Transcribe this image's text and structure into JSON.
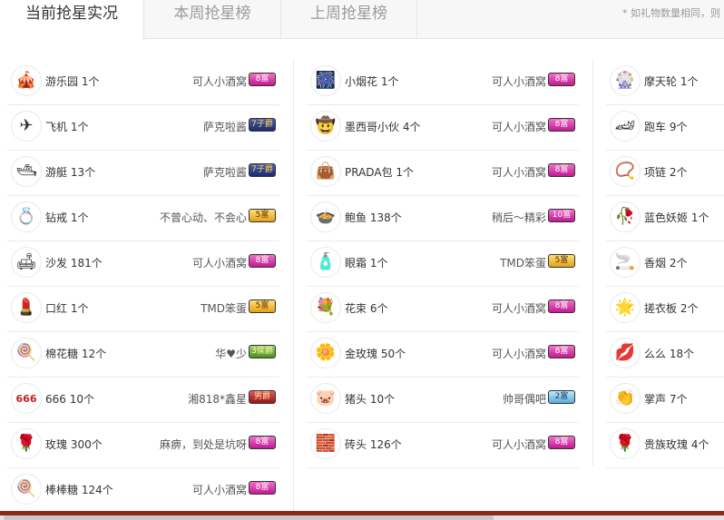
{
  "tabs": [
    {
      "label": "当前抢星实况",
      "active": true
    },
    {
      "label": "本周抢星榜",
      "active": false
    },
    {
      "label": "上周抢星榜",
      "active": false
    }
  ],
  "note": "* 如礼物数量相同，则",
  "columns": [
    [
      {
        "gift": "游乐园 1个",
        "user": "可人小酒窝",
        "badge": "8富",
        "color": "pink",
        "icon": "amusement-park",
        "glyph": "🎪"
      },
      {
        "gift": "飞机 1个",
        "user": "萨克啦酱",
        "badge": "7子爵",
        "color": "navy",
        "icon": "airplane",
        "glyph": "✈"
      },
      {
        "gift": "游艇 13个",
        "user": "萨克啦酱",
        "badge": "7子爵",
        "color": "navy",
        "icon": "yacht",
        "glyph": "🛥"
      },
      {
        "gift": "钻戒 1个",
        "user": "不曾心动、不会心",
        "badge": "5富",
        "color": "gold",
        "icon": "diamond-ring",
        "glyph": "💍"
      },
      {
        "gift": "沙发 181个",
        "user": "可人小酒窝",
        "badge": "8富",
        "color": "pink",
        "icon": "sofa",
        "glyph": "🛋"
      },
      {
        "gift": "口红 1个",
        "user": "TMD笨蛋",
        "badge": "5富",
        "color": "gold",
        "icon": "lipstick",
        "glyph": "💄"
      },
      {
        "gift": "棉花糖 12个",
        "user": "华♥少",
        "badge": "3侯爵",
        "color": "green",
        "icon": "cotton-candy",
        "glyph": "🍭"
      },
      {
        "gift": "666 10个",
        "user": "湘818*鑫星",
        "badge": "男爵",
        "color": "red",
        "icon": "666",
        "glyph": "666"
      },
      {
        "gift": "玫瑰 300个",
        "user": "麻痹，到处是坑呀",
        "badge": "8富",
        "color": "pink",
        "icon": "rose",
        "glyph": "🌹"
      },
      {
        "gift": "棒棒糖 124个",
        "user": "可人小酒窝",
        "badge": "8富",
        "color": "pink",
        "icon": "lollipop",
        "glyph": "🍭"
      }
    ],
    [
      {
        "gift": "小烟花 1个",
        "user": "可人小酒窝",
        "badge": "8富",
        "color": "pink",
        "icon": "fireworks",
        "glyph": "🎆"
      },
      {
        "gift": "墨西哥小伙 4个",
        "user": "可人小酒窝",
        "badge": "8富",
        "color": "pink",
        "icon": "mexican-guy",
        "glyph": "🤠"
      },
      {
        "gift": "PRADA包 1个",
        "user": "可人小酒窝",
        "badge": "8富",
        "color": "pink",
        "icon": "handbag",
        "glyph": "👜"
      },
      {
        "gift": "鲍鱼 138个",
        "user": "稍后～精彩",
        "badge": "10富",
        "color": "pink",
        "icon": "abalone",
        "glyph": "🍲"
      },
      {
        "gift": "眼霜 1个",
        "user": "TMD笨蛋",
        "badge": "5富",
        "color": "gold",
        "icon": "eye-cream",
        "glyph": "🧴"
      },
      {
        "gift": "花束 6个",
        "user": "可人小酒窝",
        "badge": "8富",
        "color": "pink",
        "icon": "bouquet",
        "glyph": "💐"
      },
      {
        "gift": "金玫瑰 50个",
        "user": "可人小酒窝",
        "badge": "8富",
        "color": "pink",
        "icon": "gold-rose",
        "glyph": "🌼"
      },
      {
        "gift": "猪头 10个",
        "user": "帅哥偶吧",
        "badge": "2富",
        "color": "cyan",
        "icon": "pig-head",
        "glyph": "🐷"
      },
      {
        "gift": "砖头 126个",
        "user": "可人小酒窝",
        "badge": "8富",
        "color": "pink",
        "icon": "brick",
        "glyph": "🧱"
      }
    ],
    [
      {
        "gift": "摩天轮 1个",
        "icon": "ferris-wheel",
        "glyph": "🎡"
      },
      {
        "gift": "跑车 9个",
        "icon": "sports-car",
        "glyph": "🏎"
      },
      {
        "gift": "项链 2个",
        "icon": "necklace",
        "glyph": "📿"
      },
      {
        "gift": "蓝色妖姬 1个",
        "icon": "blue-rose",
        "glyph": "🥀"
      },
      {
        "gift": "香烟 2个",
        "icon": "cigarette",
        "glyph": "🚬"
      },
      {
        "gift": "搓衣板 2个",
        "icon": "washboard",
        "glyph": "🌟"
      },
      {
        "gift": "么么 18个",
        "icon": "kiss-lips",
        "glyph": "💋"
      },
      {
        "gift": "掌声 7个",
        "icon": "applause",
        "glyph": "👏"
      },
      {
        "gift": "贵族玫瑰 4个",
        "icon": "noble-rose",
        "glyph": "🌹"
      }
    ]
  ]
}
